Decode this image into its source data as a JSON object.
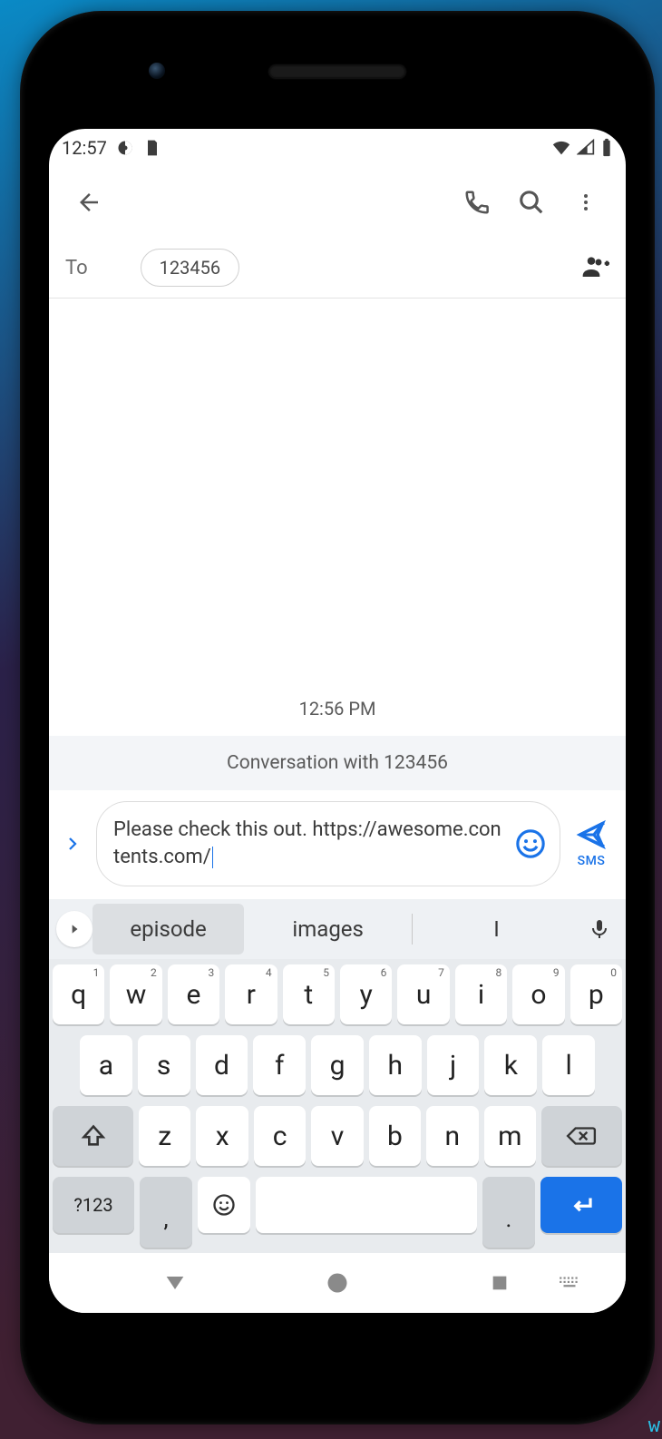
{
  "status": {
    "time": "12:57"
  },
  "to": {
    "label": "To",
    "recipient": "123456"
  },
  "conversation": {
    "timestamp": "12:56 PM",
    "header": "Conversation with 123456"
  },
  "compose": {
    "text": "Please check this out. https://awesome.contents.com/",
    "send_label": "SMS"
  },
  "suggestions": {
    "items": [
      "episode",
      "images",
      "I"
    ]
  },
  "keyboard": {
    "row1": [
      {
        "k": "q",
        "s": "1"
      },
      {
        "k": "w",
        "s": "2"
      },
      {
        "k": "e",
        "s": "3"
      },
      {
        "k": "r",
        "s": "4"
      },
      {
        "k": "t",
        "s": "5"
      },
      {
        "k": "y",
        "s": "6"
      },
      {
        "k": "u",
        "s": "7"
      },
      {
        "k": "i",
        "s": "8"
      },
      {
        "k": "o",
        "s": "9"
      },
      {
        "k": "p",
        "s": "0"
      }
    ],
    "row2": [
      "a",
      "s",
      "d",
      "f",
      "g",
      "h",
      "j",
      "k",
      "l"
    ],
    "row3": [
      "z",
      "x",
      "c",
      "v",
      "b",
      "n",
      "m"
    ],
    "sym": "?123",
    "comma": ",",
    "dot": "."
  }
}
